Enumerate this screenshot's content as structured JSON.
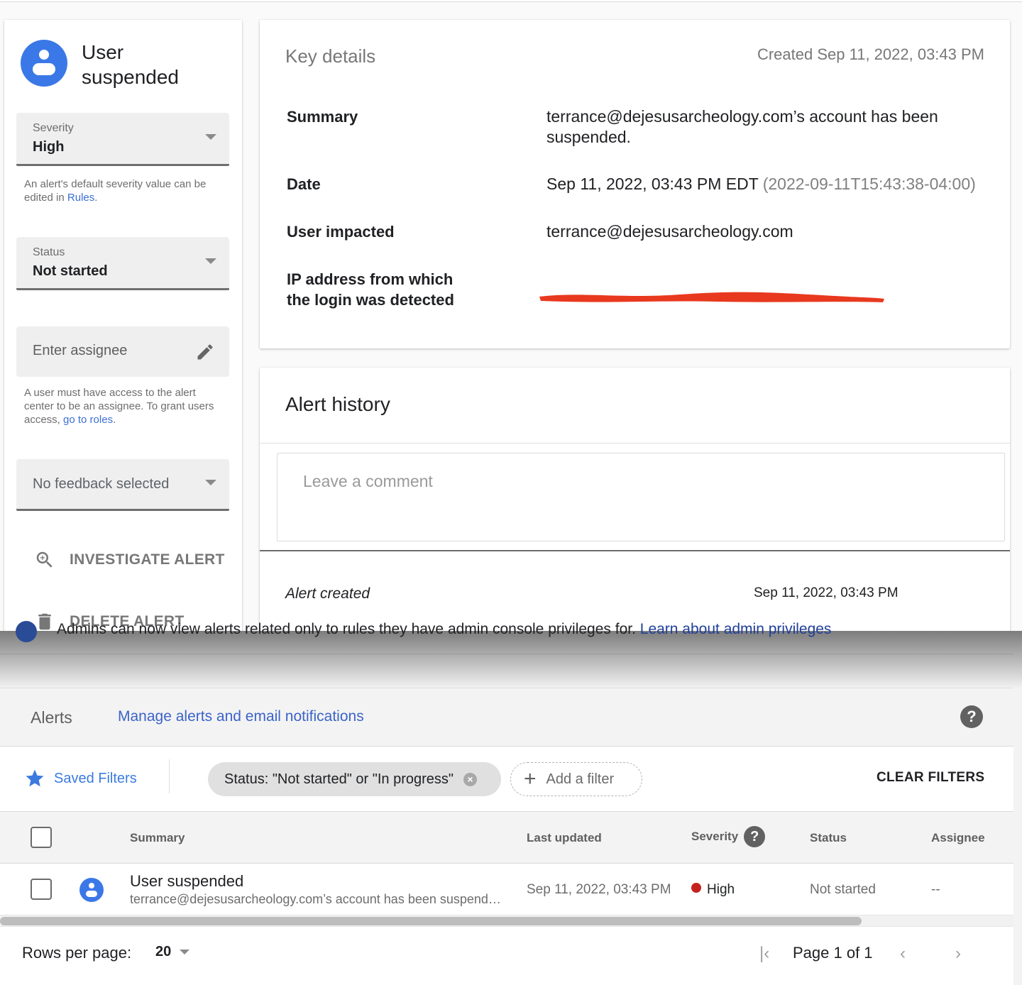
{
  "detail": {
    "alert_title": "User suspended",
    "severity": {
      "label": "Severity",
      "value": "High"
    },
    "severity_help": {
      "prefix": "An alert's default severity value can be edited in ",
      "link": "Rules",
      "suffix": "."
    },
    "status": {
      "label": "Status",
      "value": "Not started"
    },
    "assignee": {
      "placeholder": "Enter assignee"
    },
    "assignee_help": {
      "prefix": "A user must have access to the alert center to be an assignee. To grant users access, ",
      "link": "go to roles",
      "suffix": "."
    },
    "feedback": {
      "value": "No feedback selected"
    },
    "actions": {
      "investigate": "INVESTIGATE ALERT",
      "delete": "DELETE ALERT"
    },
    "key_details": {
      "title": "Key details",
      "created": "Created Sep 11, 2022, 03:43 PM",
      "rows": [
        {
          "label": "Summary",
          "value": "terrance@dejesusarcheology.com’s account has been suspended."
        },
        {
          "label": "Date",
          "value": "Sep 11, 2022, 03:43 PM EDT",
          "extra": "(2022-09-11T15:43:38-04:00)"
        },
        {
          "label": "User impacted",
          "value": "terrance@dejesusarcheology.com"
        },
        {
          "label": "IP address from which the login was detected",
          "value": "[redacted]"
        }
      ],
      "redaction_color": "#e8391f"
    },
    "history": {
      "title": "Alert history",
      "comment_placeholder": "Leave a comment",
      "events": [
        {
          "event": "Alert created",
          "time": "Sep 11, 2022, 03:43 PM"
        }
      ]
    }
  },
  "banner": {
    "text": "Admins can now view alerts related only to rules they have admin console privileges for.",
    "link": "Learn about admin privileges"
  },
  "list": {
    "title": "Alerts",
    "manage_link": "Manage alerts and email notifications",
    "saved_filters": "Saved Filters",
    "active_filter": "Status: \"Not started\" or \"In progress\"",
    "add_filter": "Add a filter",
    "clear_filters": "CLEAR FILTERS",
    "columns": [
      "Summary",
      "Last updated",
      "Severity",
      "Status",
      "Assignee"
    ],
    "rows": [
      {
        "title": "User suspended",
        "subtitle": "terrance@dejesusarcheology.com’s account has been suspended.",
        "last_updated": "Sep 11, 2022, 03:43 PM",
        "severity": "High",
        "status": "Not started",
        "assignee": "--"
      }
    ],
    "scroll_fraction": 0.85,
    "pagination": {
      "rows_per_page_label": "Rows per page:",
      "rows_per_page": "20",
      "page_label": "Page 1 of 1"
    }
  },
  "colors": {
    "accent_blue": "#3b78e7",
    "link_blue": "#3b64c8",
    "severity_high": "#c5221f"
  }
}
